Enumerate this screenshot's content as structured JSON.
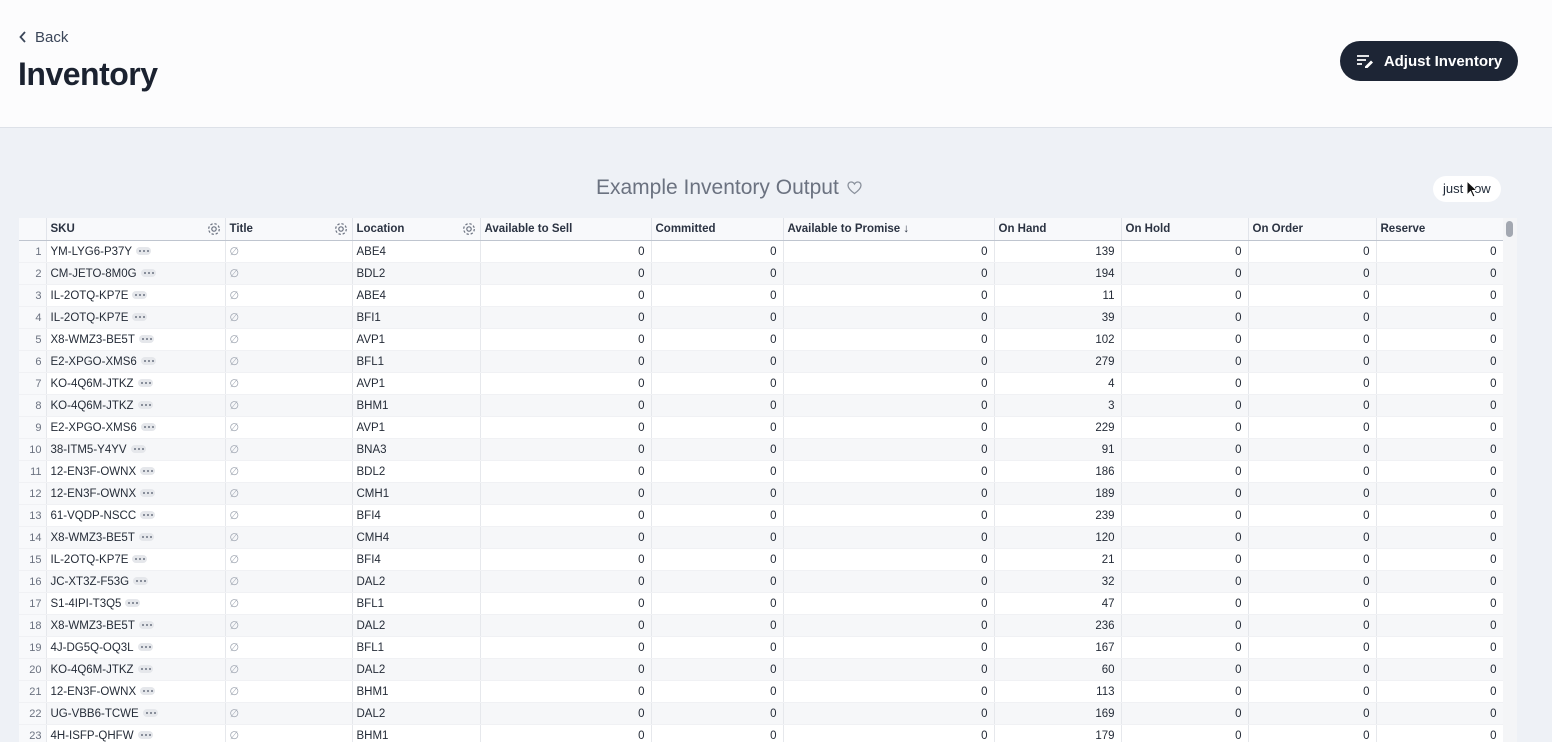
{
  "header": {
    "back_label": "Back",
    "title": "Inventory",
    "adjust_label": "Adjust Inventory"
  },
  "report": {
    "title": "Example Inventory Output",
    "timestamp": "just now"
  },
  "table": {
    "columns": [
      "SKU",
      "Title",
      "Location",
      "Available to Sell",
      "Committed",
      "Available to Promise ↓",
      "On Hand",
      "On Hold",
      "On Order",
      "Reserve"
    ],
    "null_glyph": "∅",
    "rows": [
      {
        "n": "1",
        "sku": "YM-LYG6-P37Y",
        "loc": "ABE4",
        "ats": "0",
        "com": "0",
        "atp": "0",
        "hand": "139",
        "hold": "0",
        "order": "0",
        "res": "0"
      },
      {
        "n": "2",
        "sku": "CM-JETO-8M0G",
        "loc": "BDL2",
        "ats": "0",
        "com": "0",
        "atp": "0",
        "hand": "194",
        "hold": "0",
        "order": "0",
        "res": "0"
      },
      {
        "n": "3",
        "sku": "IL-2OTQ-KP7E",
        "loc": "ABE4",
        "ats": "0",
        "com": "0",
        "atp": "0",
        "hand": "11",
        "hold": "0",
        "order": "0",
        "res": "0"
      },
      {
        "n": "4",
        "sku": "IL-2OTQ-KP7E",
        "loc": "BFI1",
        "ats": "0",
        "com": "0",
        "atp": "0",
        "hand": "39",
        "hold": "0",
        "order": "0",
        "res": "0"
      },
      {
        "n": "5",
        "sku": "X8-WMZ3-BE5T",
        "loc": "AVP1",
        "ats": "0",
        "com": "0",
        "atp": "0",
        "hand": "102",
        "hold": "0",
        "order": "0",
        "res": "0"
      },
      {
        "n": "6",
        "sku": "E2-XPGO-XMS6",
        "loc": "BFL1",
        "ats": "0",
        "com": "0",
        "atp": "0",
        "hand": "279",
        "hold": "0",
        "order": "0",
        "res": "0"
      },
      {
        "n": "7",
        "sku": "KO-4Q6M-JTKZ",
        "loc": "AVP1",
        "ats": "0",
        "com": "0",
        "atp": "0",
        "hand": "4",
        "hold": "0",
        "order": "0",
        "res": "0"
      },
      {
        "n": "8",
        "sku": "KO-4Q6M-JTKZ",
        "loc": "BHM1",
        "ats": "0",
        "com": "0",
        "atp": "0",
        "hand": "3",
        "hold": "0",
        "order": "0",
        "res": "0"
      },
      {
        "n": "9",
        "sku": "E2-XPGO-XMS6",
        "loc": "AVP1",
        "ats": "0",
        "com": "0",
        "atp": "0",
        "hand": "229",
        "hold": "0",
        "order": "0",
        "res": "0"
      },
      {
        "n": "10",
        "sku": "38-ITM5-Y4YV",
        "loc": "BNA3",
        "ats": "0",
        "com": "0",
        "atp": "0",
        "hand": "91",
        "hold": "0",
        "order": "0",
        "res": "0"
      },
      {
        "n": "11",
        "sku": "12-EN3F-OWNX",
        "loc": "BDL2",
        "ats": "0",
        "com": "0",
        "atp": "0",
        "hand": "186",
        "hold": "0",
        "order": "0",
        "res": "0"
      },
      {
        "n": "12",
        "sku": "12-EN3F-OWNX",
        "loc": "CMH1",
        "ats": "0",
        "com": "0",
        "atp": "0",
        "hand": "189",
        "hold": "0",
        "order": "0",
        "res": "0"
      },
      {
        "n": "13",
        "sku": "61-VQDP-NSCC",
        "loc": "BFI4",
        "ats": "0",
        "com": "0",
        "atp": "0",
        "hand": "239",
        "hold": "0",
        "order": "0",
        "res": "0"
      },
      {
        "n": "14",
        "sku": "X8-WMZ3-BE5T",
        "loc": "CMH4",
        "ats": "0",
        "com": "0",
        "atp": "0",
        "hand": "120",
        "hold": "0",
        "order": "0",
        "res": "0"
      },
      {
        "n": "15",
        "sku": "IL-2OTQ-KP7E",
        "loc": "BFI4",
        "ats": "0",
        "com": "0",
        "atp": "0",
        "hand": "21",
        "hold": "0",
        "order": "0",
        "res": "0"
      },
      {
        "n": "16",
        "sku": "JC-XT3Z-F53G",
        "loc": "DAL2",
        "ats": "0",
        "com": "0",
        "atp": "0",
        "hand": "32",
        "hold": "0",
        "order": "0",
        "res": "0"
      },
      {
        "n": "17",
        "sku": "S1-4IPI-T3Q5",
        "loc": "BFL1",
        "ats": "0",
        "com": "0",
        "atp": "0",
        "hand": "47",
        "hold": "0",
        "order": "0",
        "res": "0"
      },
      {
        "n": "18",
        "sku": "X8-WMZ3-BE5T",
        "loc": "DAL2",
        "ats": "0",
        "com": "0",
        "atp": "0",
        "hand": "236",
        "hold": "0",
        "order": "0",
        "res": "0"
      },
      {
        "n": "19",
        "sku": "4J-DG5Q-OQ3L",
        "loc": "BFL1",
        "ats": "0",
        "com": "0",
        "atp": "0",
        "hand": "167",
        "hold": "0",
        "order": "0",
        "res": "0"
      },
      {
        "n": "20",
        "sku": "KO-4Q6M-JTKZ",
        "loc": "DAL2",
        "ats": "0",
        "com": "0",
        "atp": "0",
        "hand": "60",
        "hold": "0",
        "order": "0",
        "res": "0"
      },
      {
        "n": "21",
        "sku": "12-EN3F-OWNX",
        "loc": "BHM1",
        "ats": "0",
        "com": "0",
        "atp": "0",
        "hand": "113",
        "hold": "0",
        "order": "0",
        "res": "0"
      },
      {
        "n": "22",
        "sku": "UG-VBB6-TCWE",
        "loc": "DAL2",
        "ats": "0",
        "com": "0",
        "atp": "0",
        "hand": "169",
        "hold": "0",
        "order": "0",
        "res": "0"
      },
      {
        "n": "23",
        "sku": "4H-ISFP-QHFW",
        "loc": "BHM1",
        "ats": "0",
        "com": "0",
        "atp": "0",
        "hand": "179",
        "hold": "0",
        "order": "0",
        "res": "0"
      }
    ]
  }
}
